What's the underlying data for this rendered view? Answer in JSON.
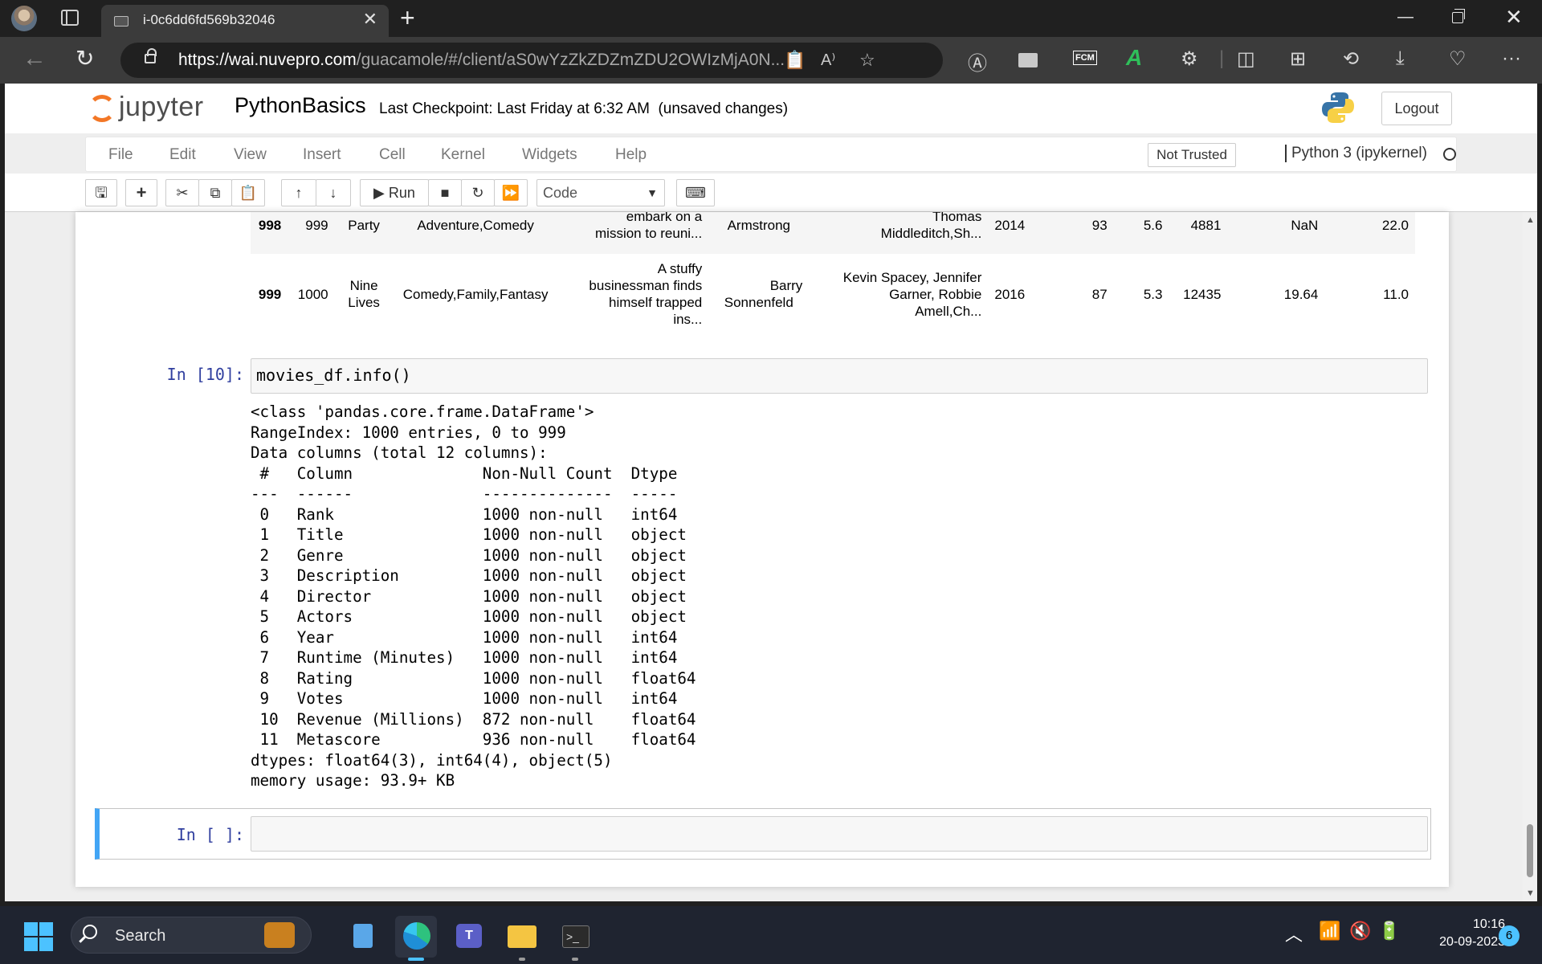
{
  "browser": {
    "tab_title": "i-0c6dd6fd569b32046",
    "url_host": "https://wai.nuvepro.com",
    "url_path": "/guacamole/#/client/aS0wYzZkZDZmZDU2OWIzMjA0N..."
  },
  "jupyter": {
    "logo_text": "jupyter",
    "notebook_name": "PythonBasics",
    "checkpoint_text": "Last Checkpoint: Last Friday at 6:32 AM",
    "unsaved_text": "(unsaved changes)",
    "logout_label": "Logout",
    "menu": [
      "File",
      "Edit",
      "View",
      "Insert",
      "Cell",
      "Kernel",
      "Widgets",
      "Help"
    ],
    "trust_label": "Not Trusted",
    "kernel_label": "Python 3 (ipykernel)",
    "run_label": "Run",
    "cell_type": "Code"
  },
  "dataframe_rows": [
    {
      "index": "998",
      "rank": "999",
      "title": "Party",
      "genre": "Adventure,Comedy",
      "description": [
        "embark on a",
        "mission to reuni..."
      ],
      "director": [
        "Armstrong"
      ],
      "actors": [
        "Thomas",
        "Middleditch,Sh..."
      ],
      "year": "2014",
      "runtime": "93",
      "rating": "5.6",
      "votes": "4881",
      "revenue": "NaN",
      "metascore": "22.0"
    },
    {
      "index": "999",
      "rank": "1000",
      "title": "Nine Lives",
      "genre": "Comedy,Family,Fantasy",
      "description": [
        "A stuffy",
        "businessman finds",
        "himself trapped",
        "ins..."
      ],
      "director": [
        "Barry",
        "Sonnenfeld"
      ],
      "actors": [
        "Kevin Spacey, Jennifer",
        "Garner, Robbie",
        "Amell,Ch..."
      ],
      "year": "2016",
      "runtime": "87",
      "rating": "5.3",
      "votes": "12435",
      "revenue": "19.64",
      "metascore": "11.0"
    }
  ],
  "cells": {
    "info_prompt": "In [10]:",
    "info_code": "movies_df.info()",
    "info_output": "<class 'pandas.core.frame.DataFrame'>\nRangeIndex: 1000 entries, 0 to 999\nData columns (total 12 columns):\n #   Column              Non-Null Count  Dtype  \n---  ------              --------------  -----  \n 0   Rank                1000 non-null   int64  \n 1   Title               1000 non-null   object \n 2   Genre               1000 non-null   object \n 3   Description         1000 non-null   object \n 4   Director            1000 non-null   object \n 5   Actors              1000 non-null   object \n 6   Year                1000 non-null   int64  \n 7   Runtime (Minutes)   1000 non-null   int64  \n 8   Rating              1000 non-null   float64\n 9   Votes               1000 non-null   int64  \n 10  Revenue (Millions)  872 non-null    float64\n 11  Metascore           936 non-null    float64\ndtypes: float64(3), int64(4), object(5)\nmemory usage: 93.9+ KB",
    "empty_prompt": "In [ ]:"
  },
  "taskbar": {
    "search_label": "Search",
    "time": "10:16",
    "date": "20-09-2023",
    "notification_count": "6"
  },
  "colors": {
    "accent": "#42a5f5",
    "prompt": "#303f9f",
    "jupyter_orange": "#f37726"
  }
}
